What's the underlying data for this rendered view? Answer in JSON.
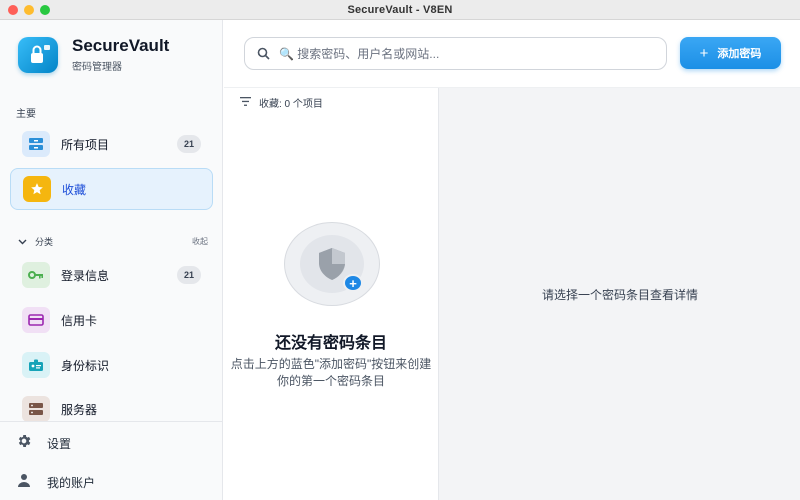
{
  "window": {
    "title": "SecureVault - V8EN"
  },
  "brand": {
    "name": "SecureVault",
    "subtitle": "密码管理器"
  },
  "sidebar": {
    "section_label": "主要",
    "main_items": [
      {
        "label": "所有项目",
        "count": "21",
        "icon": "inbox-icon",
        "color": "#2b8fd8"
      },
      {
        "label": "收藏",
        "icon": "star-icon",
        "color": "#f5b60f",
        "active": true
      }
    ],
    "category_label": "分类",
    "collapse_label": "收起",
    "category_items": [
      {
        "label": "登录信息",
        "count": "21",
        "icon": "key-icon",
        "color": "#4caf50"
      },
      {
        "label": "信用卡",
        "icon": "credit-card-icon",
        "color": "#9c27b0"
      },
      {
        "label": "身份标识",
        "icon": "id-badge-icon",
        "color": "#16a3b8"
      },
      {
        "label": "服务器",
        "icon": "server-icon",
        "color": "#795548"
      }
    ],
    "settings_label": "设置",
    "account_label": "我的账户"
  },
  "search": {
    "placeholder": "🔍 搜索密码、用户名或网站..."
  },
  "header": {
    "add_button_label": "添加密码"
  },
  "list": {
    "filter_text": "收藏: 0 个项目",
    "empty_title": "还没有密码条目",
    "empty_description": "点击上方的蓝色\"添加密码\"按钮来创建你的第一个密码条目"
  },
  "detail": {
    "hint": "请选择一个密码条目查看详情"
  },
  "colors": {
    "accent": "#1e88e5",
    "active_bg": "#e6f2fd"
  }
}
